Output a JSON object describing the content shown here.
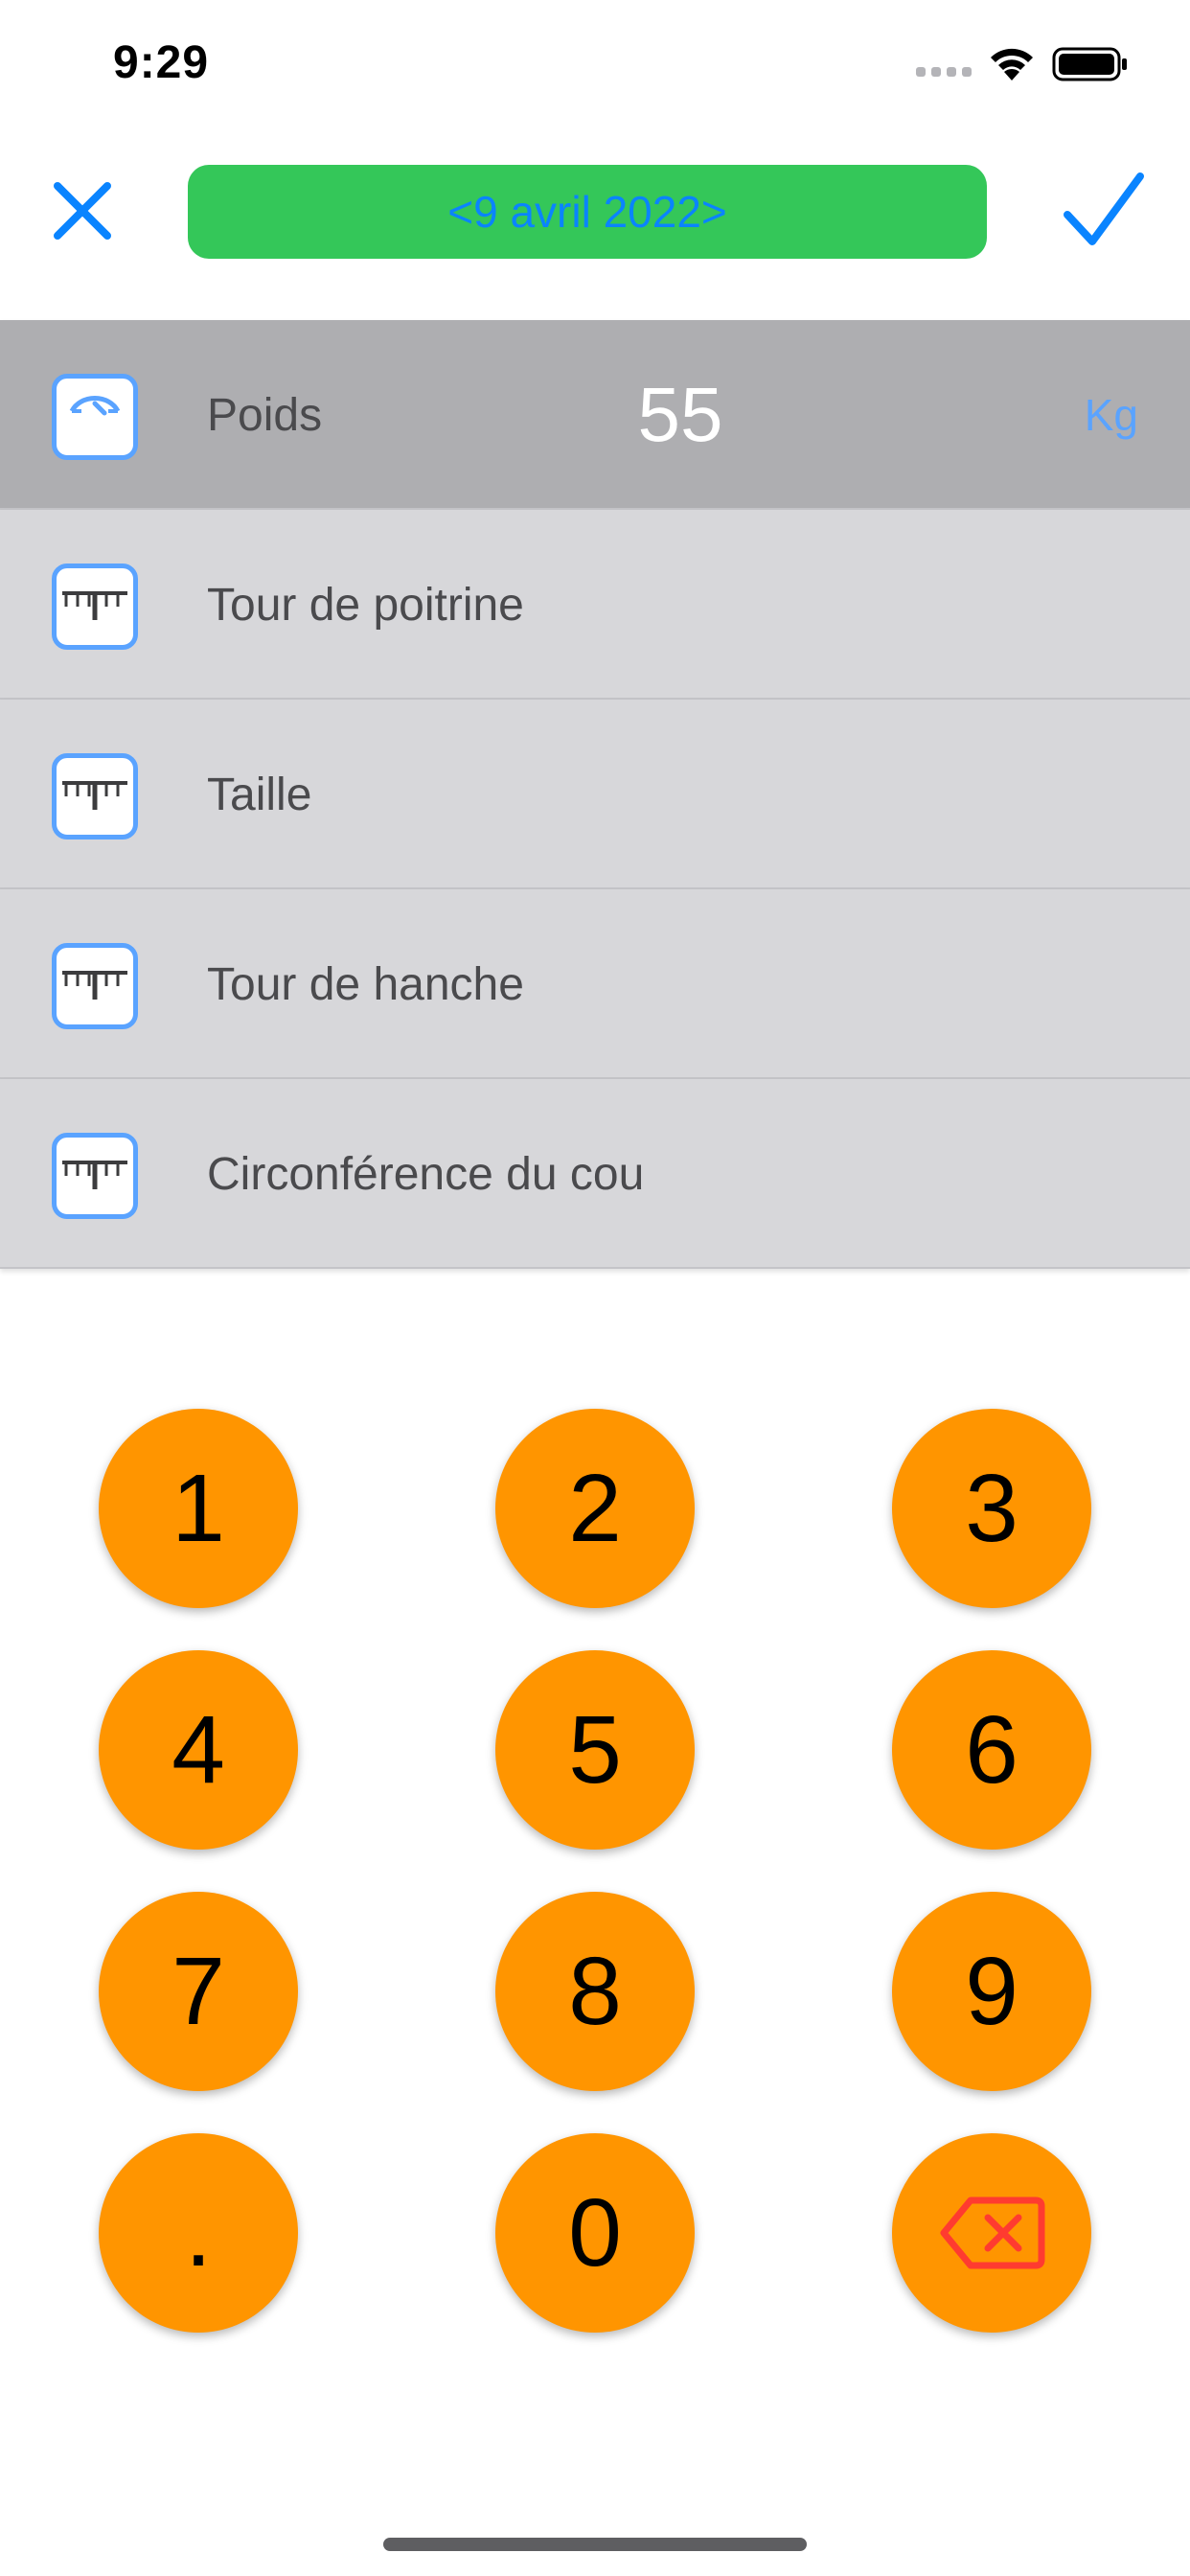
{
  "status_bar": {
    "time": "9:29"
  },
  "header": {
    "date_label": "<9 avril 2022>",
    "date_button_color": "#34c759",
    "date_text_color": "#0a84ff",
    "accent_color": "#0a84ff",
    "close_icon": "close-icon",
    "confirm_icon": "checkmark-icon"
  },
  "measurements": [
    {
      "label": "Poids",
      "value": "55",
      "unit": "Kg",
      "icon": "scale-icon",
      "selected": true
    },
    {
      "label": "Tour de poitrine",
      "value": "",
      "unit": "",
      "icon": "ruler-icon",
      "selected": false
    },
    {
      "label": "Taille",
      "value": "",
      "unit": "",
      "icon": "ruler-icon",
      "selected": false
    },
    {
      "label": "Tour de hanche",
      "value": "",
      "unit": "",
      "icon": "ruler-icon",
      "selected": false
    },
    {
      "label": "Circonférence du cou",
      "value": "",
      "unit": "",
      "icon": "ruler-icon",
      "selected": false
    }
  ],
  "keypad": {
    "keys": [
      "1",
      "2",
      "3",
      "4",
      "5",
      "6",
      "7",
      "8",
      "9",
      ".",
      "0"
    ],
    "backspace_icon": "backspace-icon",
    "key_color": "#ff9500",
    "backspace_color": "#ff3b30"
  }
}
